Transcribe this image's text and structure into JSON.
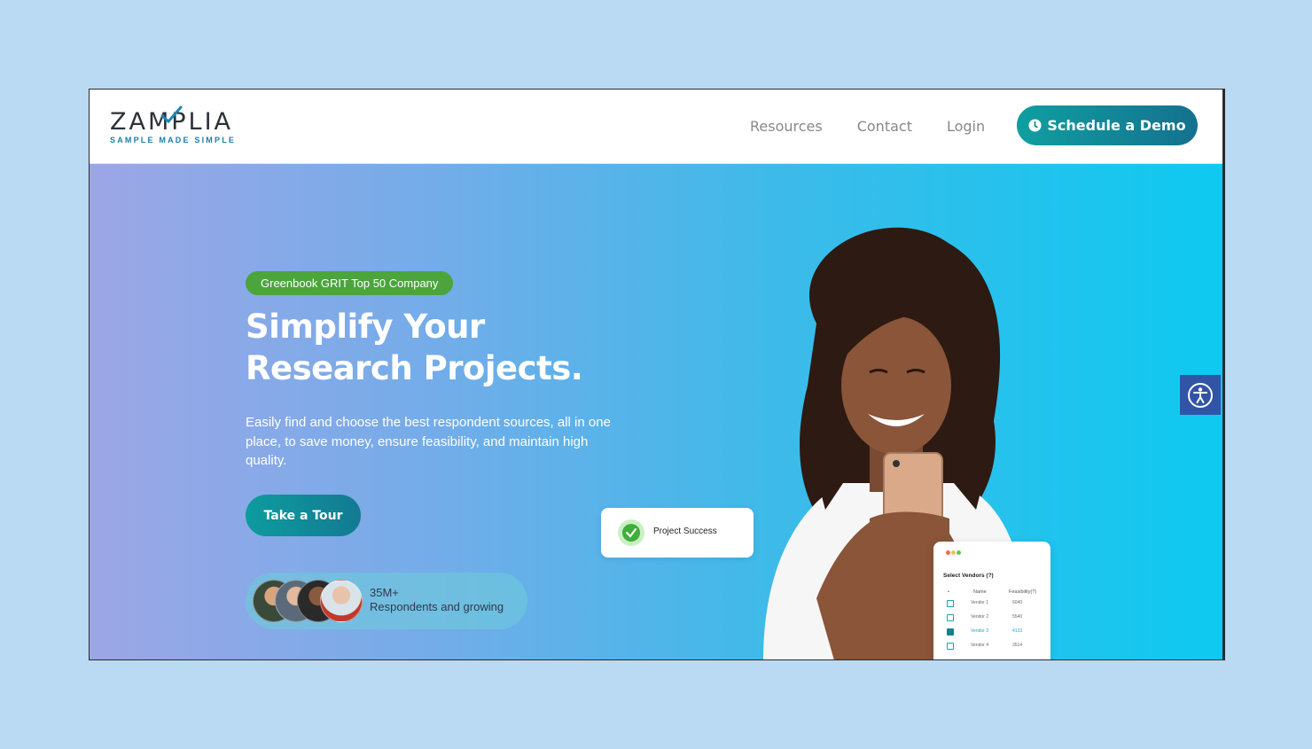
{
  "header": {
    "logo_text": "ZAMPLIA",
    "logo_tagline": "SAMPLE MADE SIMPLE",
    "nav": [
      "Resources",
      "Contact",
      "Login"
    ],
    "cta_label": "Schedule a Demo"
  },
  "hero": {
    "badge": "Greenbook GRIT Top 50 Company",
    "headline_line1": "Simplify Your",
    "headline_line2": "Research Projects.",
    "description": "Easily find and choose the best respondent sources, all in one place, to save money, ensure feasibility, and maintain high quality.",
    "tour_label": "Take a Tour",
    "respondents_count": "35M+",
    "respondents_label": "Respondents and growing"
  },
  "success_card": {
    "label": "Project Success"
  },
  "vendor_card": {
    "title": "Select Vendors (?)",
    "col_index": "•",
    "col_name": "Name",
    "col_feasibility": "Feasibility(?)",
    "rows": [
      {
        "name": "Vendor 1",
        "feasibility": "6040",
        "checked": false
      },
      {
        "name": "Vendor 2",
        "feasibility": "5540",
        "checked": false
      },
      {
        "name": "Vendor 3",
        "feasibility": "4133",
        "checked": true
      },
      {
        "name": "Vendor 4",
        "feasibility": "3514",
        "checked": false
      }
    ]
  },
  "colors": {
    "brand_teal": "#14818f",
    "badge_green": "#4ca43d",
    "accessibility_blue": "#3154a6",
    "page_background": "#bad9f3"
  },
  "icons": {
    "cta": "clock-icon",
    "success": "check-circle-icon",
    "accessibility": "accessibility-icon"
  }
}
